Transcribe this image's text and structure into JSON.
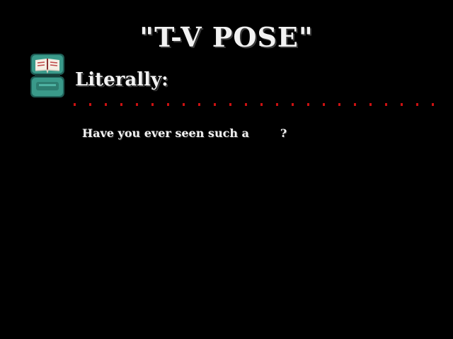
{
  "dialog": {
    "title": "\"T-V POSE\"",
    "label": "Literally:",
    "line_before": "Have you ever seen such a",
    "line_after": "?"
  },
  "colors": {
    "background": "#000000",
    "text": "#f2f2f2",
    "dots": "#cc1111",
    "book_teal": "#3a9a8a",
    "book_pages": "#f5efe4"
  },
  "icons": {
    "book": "book-icon"
  }
}
